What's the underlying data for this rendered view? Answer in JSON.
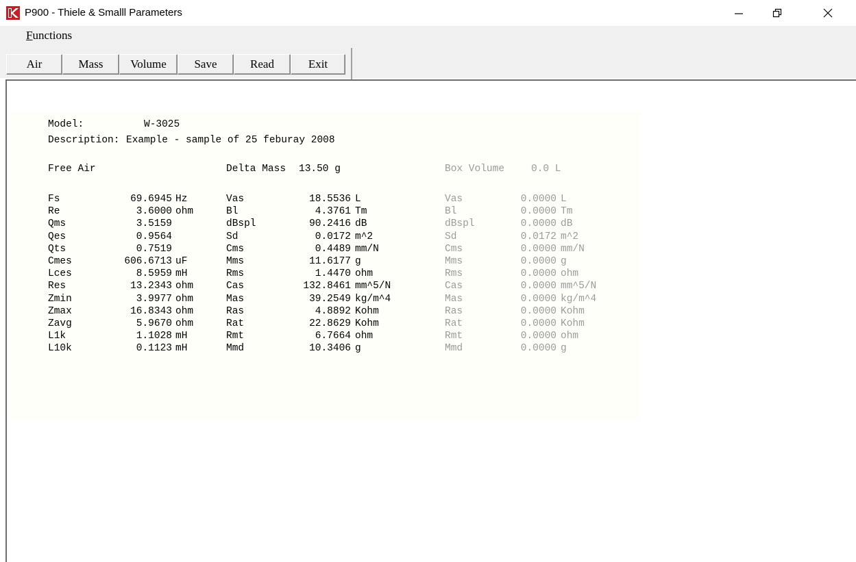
{
  "window": {
    "title": "P900 - Thiele & Smalll Parameters",
    "minimize_icon": "minimize-icon",
    "restore_icon": "restore-icon",
    "close_icon": "close-icon"
  },
  "menu": {
    "functions_hotkey": "F",
    "functions_rest": "unctions"
  },
  "toolbar": {
    "buttons": [
      "Air",
      "Mass",
      "Volume",
      "Save",
      "Read",
      "Exit"
    ]
  },
  "header": {
    "model_label": "Model:",
    "model_value": "W-3025",
    "description_label": "Description:",
    "description_value": "Example - sample of 25 feburay 2008"
  },
  "sections": {
    "free_air": "Free Air",
    "delta_mass_label": "Delta Mass",
    "delta_mass_value": "13.50 g",
    "box_volume_label": "Box Volume",
    "box_volume_value": "0.0 L"
  },
  "free_air": [
    {
      "name": "Fs",
      "value": "69.6945",
      "unit": "Hz"
    },
    {
      "name": "Re",
      "value": "3.6000",
      "unit": "ohm"
    },
    {
      "name": "Qms",
      "value": "3.5159",
      "unit": ""
    },
    {
      "name": "Qes",
      "value": "0.9564",
      "unit": ""
    },
    {
      "name": "Qts",
      "value": "0.7519",
      "unit": ""
    },
    {
      "name": "Cmes",
      "value": "606.6713",
      "unit": "uF"
    },
    {
      "name": "Lces",
      "value": "8.5959",
      "unit": "mH"
    },
    {
      "name": "Res",
      "value": "13.2343",
      "unit": "ohm"
    },
    {
      "name": "Zmin",
      "value": "3.9977",
      "unit": "ohm"
    },
    {
      "name": "Zmax",
      "value": "16.8343",
      "unit": "ohm"
    },
    {
      "name": "Zavg",
      "value": "5.9670",
      "unit": "ohm"
    },
    {
      "name": "L1k",
      "value": "1.1028",
      "unit": "mH"
    },
    {
      "name": "L10k",
      "value": "0.1123",
      "unit": "mH"
    }
  ],
  "delta_mass": [
    {
      "name": "Vas",
      "value": "18.5536",
      "unit": "L"
    },
    {
      "name": "Bl",
      "value": "4.3761",
      "unit": "Tm"
    },
    {
      "name": "dBspl",
      "value": "90.2416",
      "unit": "dB"
    },
    {
      "name": "Sd",
      "value": "0.0172",
      "unit": "m^2"
    },
    {
      "name": "Cms",
      "value": "0.4489",
      "unit": "mm/N"
    },
    {
      "name": "Mms",
      "value": "11.6177",
      "unit": "g"
    },
    {
      "name": "Rms",
      "value": "1.4470",
      "unit": "ohm"
    },
    {
      "name": "Cas",
      "value": "132.8461",
      "unit": "mm^5/N"
    },
    {
      "name": "Mas",
      "value": "39.2549",
      "unit": "kg/m^4"
    },
    {
      "name": "Ras",
      "value": "4.8892",
      "unit": "Kohm"
    },
    {
      "name": "Rat",
      "value": "22.8629",
      "unit": "Kohm"
    },
    {
      "name": "Rmt",
      "value": "6.7664",
      "unit": "ohm"
    },
    {
      "name": "Mmd",
      "value": "10.3406",
      "unit": "g"
    }
  ],
  "box_volume": [
    {
      "name": "Vas",
      "value": "0.0000",
      "unit": "L"
    },
    {
      "name": "Bl",
      "value": "0.0000",
      "unit": "Tm"
    },
    {
      "name": "dBspl",
      "value": "0.0000",
      "unit": "dB"
    },
    {
      "name": "Sd",
      "value": "0.0172",
      "unit": "m^2"
    },
    {
      "name": "Cms",
      "value": "0.0000",
      "unit": "mm/N"
    },
    {
      "name": "Mms",
      "value": "0.0000",
      "unit": "g"
    },
    {
      "name": "Rms",
      "value": "0.0000",
      "unit": "ohm"
    },
    {
      "name": "Cas",
      "value": "0.0000",
      "unit": "mm^5/N"
    },
    {
      "name": "Mas",
      "value": "0.0000",
      "unit": "kg/m^4"
    },
    {
      "name": "Ras",
      "value": "0.0000",
      "unit": "Kohm"
    },
    {
      "name": "Rat",
      "value": "0.0000",
      "unit": "Kohm"
    },
    {
      "name": "Rmt",
      "value": "0.0000",
      "unit": "ohm"
    },
    {
      "name": "Mmd",
      "value": "0.0000",
      "unit": "g"
    }
  ],
  "colors": {
    "brand_red": "#c0202a",
    "dim_text": "#9a9a9a",
    "chrome": "#f0f0f0"
  }
}
